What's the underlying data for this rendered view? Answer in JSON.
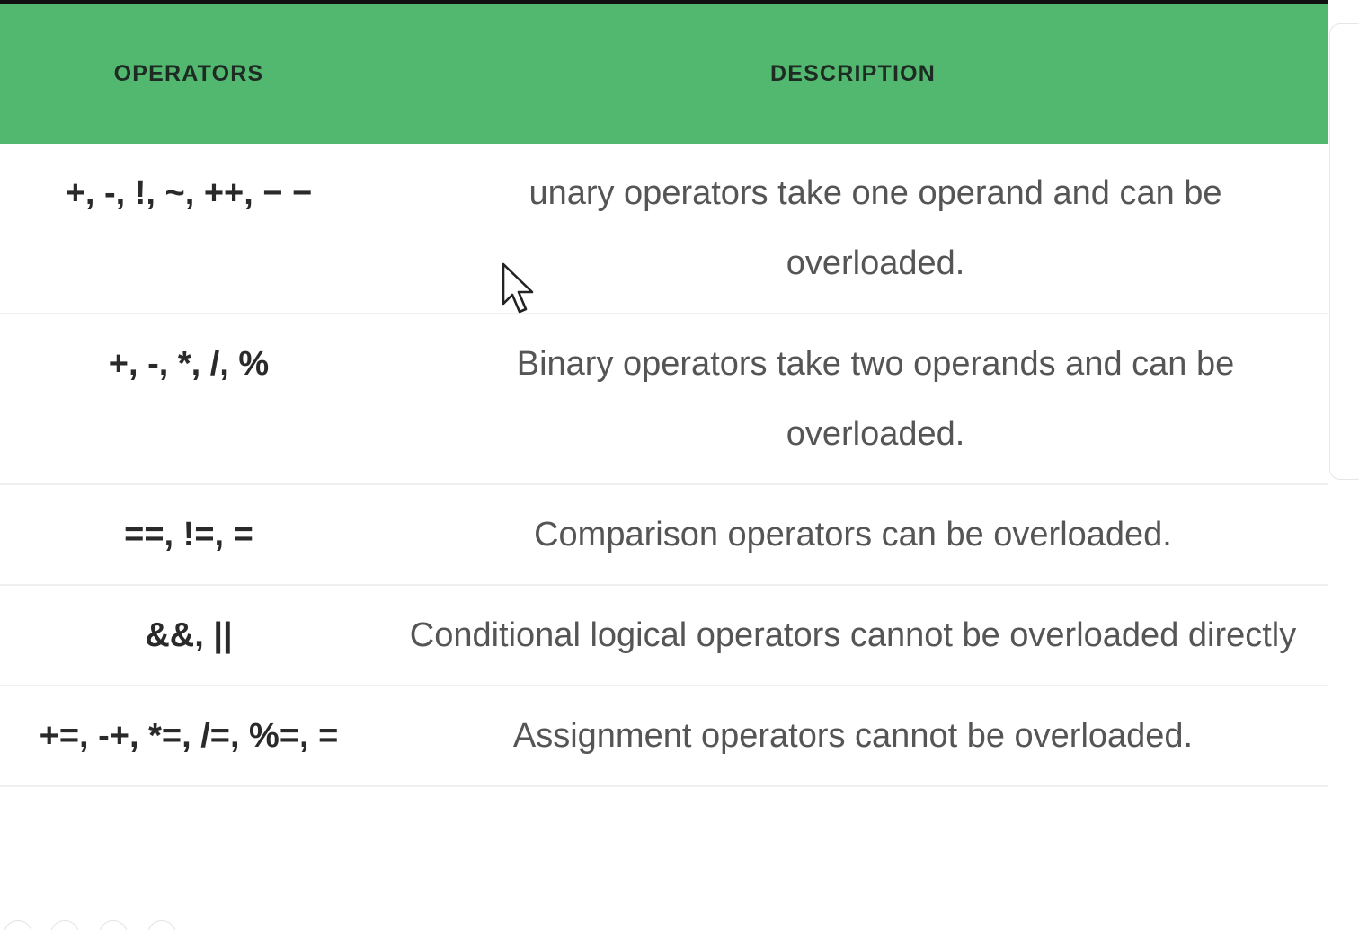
{
  "table": {
    "headers": {
      "operators": "OPERATORS",
      "description": "DESCRIPTION"
    },
    "rows": [
      {
        "operators": "+, -, !, ~, ++, − −",
        "description": "unary operators take one operand and can be overloaded."
      },
      {
        "operators": "+, -, *, /, %",
        "description": "Binary operators take two operands and can be overloaded."
      },
      {
        "operators": "==, !=, =",
        "description": "Comparison operators can be overloaded."
      },
      {
        "operators": "&&, ||",
        "description": "Conditional logical operators cannot be overloaded directly"
      },
      {
        "operators": "+=, -+, *=, /=, %=, =",
        "description": "Assignment operators cannot be overloaded."
      }
    ]
  },
  "colors": {
    "header_background": "#52b76f",
    "header_text": "#1d2b22",
    "operator_text": "#2a2a2a",
    "description_text": "#555555",
    "row_divider": "#f0f0f0"
  },
  "icons": {
    "cursor": "mouse-pointer-icon"
  }
}
